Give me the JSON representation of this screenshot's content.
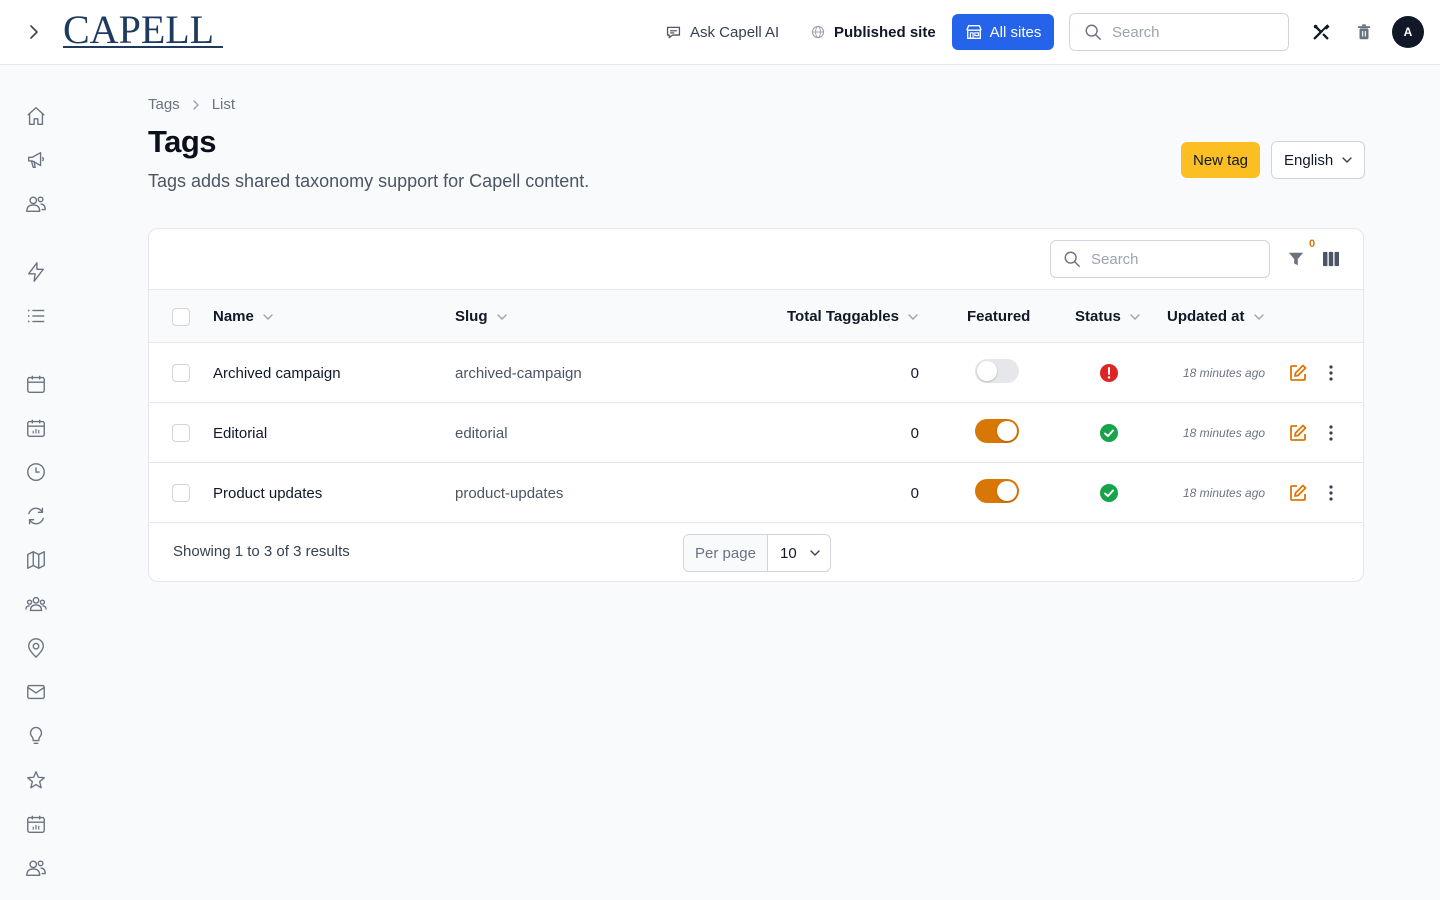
{
  "app": {
    "logo_text": "CAPELL"
  },
  "topbar": {
    "ask_label": "Ask Capell AI",
    "published_label": "Published site",
    "all_sites_label": "All sites",
    "search_placeholder": "Search",
    "avatar_initial": "A"
  },
  "breadcrumb": {
    "root": "Tags",
    "current": "List"
  },
  "page": {
    "title": "Tags",
    "description": "Tags adds shared taxonomy support for Capell content.",
    "new_button": "New tag",
    "language": "English"
  },
  "table": {
    "search_placeholder": "Search",
    "filter_count": "0",
    "columns": {
      "name": "Name",
      "slug": "Slug",
      "total": "Total Taggables",
      "featured": "Featured",
      "status": "Status",
      "updated": "Updated at"
    },
    "rows": [
      {
        "name": "Archived campaign",
        "slug": "archived-campaign",
        "total": "0",
        "featured": false,
        "status": "error",
        "updated": "18 minutes ago"
      },
      {
        "name": "Editorial",
        "slug": "editorial",
        "total": "0",
        "featured": true,
        "status": "ok",
        "updated": "18 minutes ago"
      },
      {
        "name": "Product updates",
        "slug": "product-updates",
        "total": "0",
        "featured": true,
        "status": "ok",
        "updated": "18 minutes ago"
      }
    ],
    "footer": {
      "showing": "Showing 1 to 3 of 3 results",
      "per_page_label": "Per page",
      "per_page_value": "10"
    }
  },
  "colors": {
    "primary": "#2563eb",
    "warning": "#fbbf24",
    "toggle_on": "#d97706",
    "success": "#16a34a",
    "danger": "#dc2626"
  },
  "sidebar_icons": [
    "home-icon",
    "megaphone-icon",
    "users-icon",
    "bolt-icon",
    "list-icon",
    "calendar-icon",
    "calendar-chart-icon",
    "clock-icon",
    "refresh-icon",
    "map-icon",
    "user-group-icon",
    "map-pin-icon",
    "envelope-icon",
    "lightbulb-icon",
    "star-icon",
    "calendar-chart-icon",
    "users-icon"
  ]
}
